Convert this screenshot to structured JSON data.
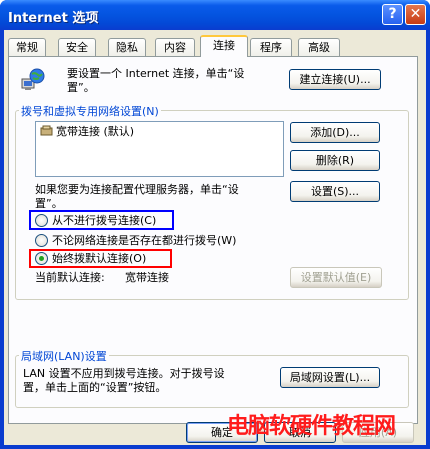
{
  "window": {
    "title": "Internet 选项"
  },
  "tabs": [
    {
      "label": "常规"
    },
    {
      "label": "安全"
    },
    {
      "label": "隐私"
    },
    {
      "label": "内容"
    },
    {
      "label": "连接"
    },
    {
      "label": "程序"
    },
    {
      "label": "高级"
    }
  ],
  "active_tab": "连接",
  "setup": {
    "text_line1": "要设置一个 Internet 连接，单击“设",
    "text_line2": "置”。",
    "button": "建立连接(U)..."
  },
  "dialup": {
    "legend": "拨号和虚拟专用网络设置(N)",
    "list_items": [
      {
        "label": "宽带连接 (默认)"
      }
    ],
    "add_button": "添加(D)...",
    "delete_button": "删除(R)",
    "settings_button": "设置(S)...",
    "proxy_text_line1": "如果您要为连接配置代理服务器，单击“设",
    "proxy_text_line2": "置”。",
    "options": [
      {
        "label": "从不进行拨号连接(C)",
        "selected": false
      },
      {
        "label": "不论网络连接是否存在都进行拨号(W)",
        "selected": false
      },
      {
        "label": "始终拨默认连接(O)",
        "selected": true
      }
    ],
    "current_default_label": "当前默认连接:",
    "current_default_value": "宽带连接",
    "set_default_button": "设置默认值(E)"
  },
  "lan": {
    "legend": "局域网(LAN)设置",
    "text_line1": "LAN 设置不应用到拨号连接。对于拨号设",
    "text_line2": "置，单击上面的“设置”按钮。",
    "button": "局域网设置(L)..."
  },
  "footer": {
    "ok": "确定",
    "cancel": "取消",
    "apply": "应用(A)"
  },
  "watermark": "电脑软硬件教程网",
  "colors": {
    "title_bar": "#0454e0",
    "highlight_blue": "#0000ff",
    "highlight_red": "#ff0000",
    "watermark": "#ff1c1c"
  }
}
